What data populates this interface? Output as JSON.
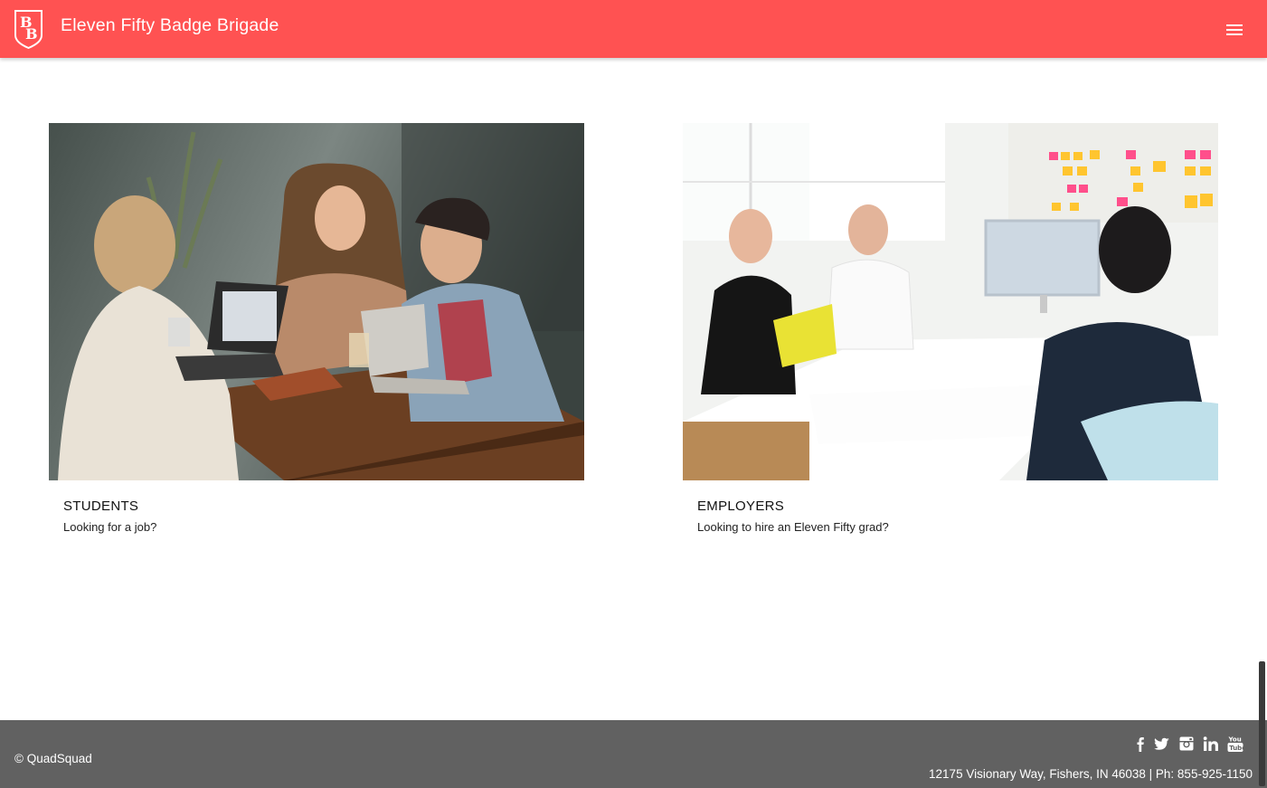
{
  "header": {
    "brand": "Eleven Fifty Badge Brigade",
    "logo_icon": "bb-shield-logo-icon",
    "menu_icon": "hamburger-menu-icon",
    "background_color": "#ff5252"
  },
  "cards": [
    {
      "title": "STUDENTS",
      "subtitle": "Looking for a job?",
      "image": "three-women-laughing-with-laptops-photo"
    },
    {
      "title": "EMPLOYERS",
      "subtitle": "Looking to hire an Eleven Fifty grad?",
      "image": "office-meeting-with-monitor-and-sticky-notes-photo"
    }
  ],
  "footer": {
    "copyright": "© QuadSquad",
    "address": "12175 Visionary Way, Fishers, IN 46038 | Ph: 855-925-1150",
    "social_icons": [
      "facebook-icon",
      "twitter-icon",
      "instagram-icon",
      "linkedin-icon",
      "youtube-icon"
    ],
    "background_color": "#616161"
  }
}
